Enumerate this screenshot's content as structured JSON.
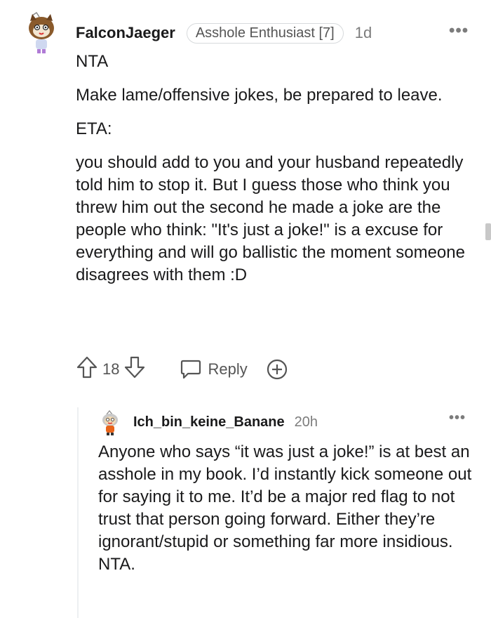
{
  "comment": {
    "username": "FalconJaeger",
    "flair": "Asshole Enthusiast [7]",
    "time": "1d",
    "paragraphs": [
      "NTA",
      "Make lame/offensive jokes, be prepared to leave.",
      "ETA:",
      "you should add to you and your husband repeatedly told him to stop it. But I guess those who think you threw him out the second he made a joke are the people who think: \"It's just a joke!\" is a excuse for everything and will go ballistic the moment someone disagrees with them :D"
    ],
    "vote_count": "18",
    "reply_label": "Reply",
    "more": "•••"
  },
  "reply": {
    "username": "Ich_bin_keine_Banane",
    "time": "20h",
    "text": "Anyone who says “it was just a joke!” is at best an asshole in my book. I’d instantly kick someone out for saying it to me. It’d be a major red flag to not trust that person going forward. Either they’re ignorant/stupid or something far more insidious. NTA.",
    "more": "•••"
  },
  "colors": {
    "text": "#1a1a1b",
    "meta": "#7c7c7c",
    "icon": "#555555",
    "border": "#d7dadc"
  }
}
